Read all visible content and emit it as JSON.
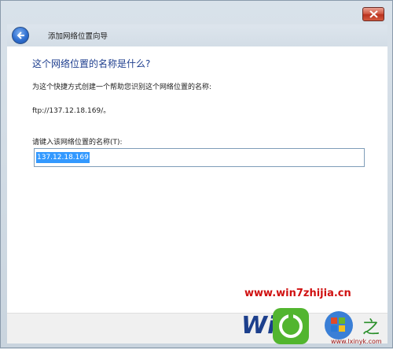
{
  "window": {
    "wizard_title": "添加网络位置向导"
  },
  "content": {
    "heading": "这个网络位置的名称是什么?",
    "description": "为这个快捷方式创建一个帮助您识别这个网络位置的名称:",
    "address": "ftp://137.12.18.169/。",
    "name_label": "请键入该网络位置的名称(T):",
    "name_value": "137.12.18.169"
  },
  "watermark": {
    "url": "www.win7zhijia.cn",
    "sub": "www.lxinyk.com",
    "logo_text": "Win7"
  },
  "colors": {
    "heading": "#1f3f8f",
    "selection": "#3399ff",
    "close_button": "#c9412d",
    "watermark": "#d01010"
  }
}
